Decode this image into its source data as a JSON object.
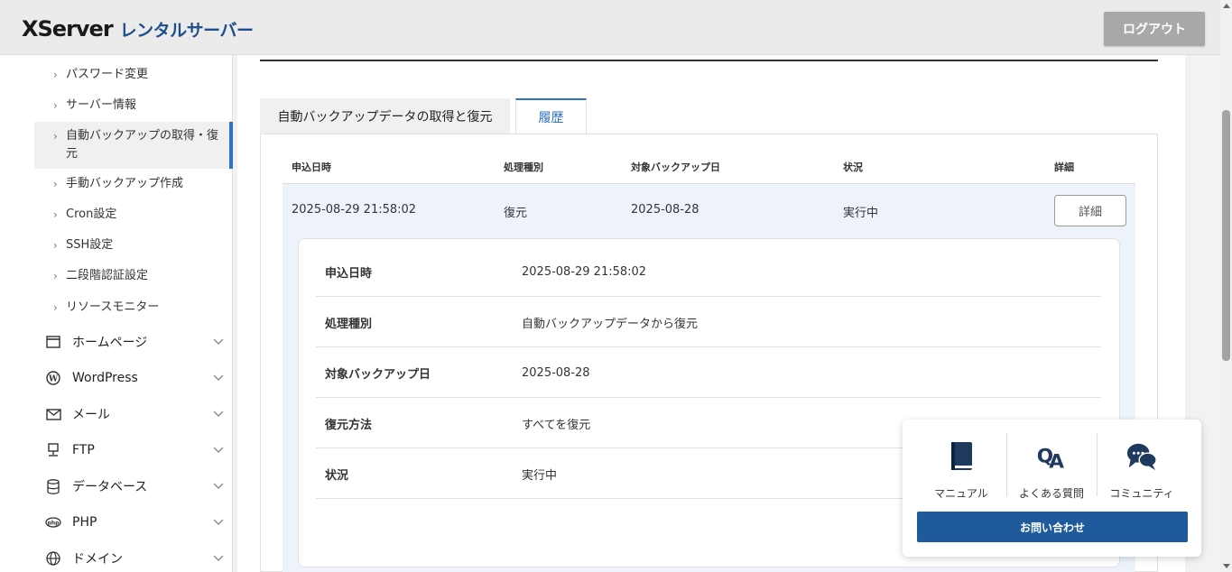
{
  "header": {
    "logo_main": "XServer",
    "logo_sub": "レンタルサーバー",
    "logout_label": "ログアウト"
  },
  "sidebar": {
    "sub_items": [
      {
        "label": "パスワード変更"
      },
      {
        "label": "サーバー情報"
      },
      {
        "label": "自動バックアップの取得・復元"
      },
      {
        "label": "手動バックアップ作成"
      },
      {
        "label": "Cron設定"
      },
      {
        "label": "SSH設定"
      },
      {
        "label": "二段階認証設定"
      },
      {
        "label": "リソースモニター"
      }
    ],
    "main_items": [
      {
        "label": "ホームページ",
        "icon": "browser-window-icon"
      },
      {
        "label": "WordPress",
        "icon": "wordpress-icon"
      },
      {
        "label": "メール",
        "icon": "mail-icon"
      },
      {
        "label": "FTP",
        "icon": "ftp-icon"
      },
      {
        "label": "データベース",
        "icon": "database-icon"
      },
      {
        "label": "PHP",
        "icon": "php-icon"
      },
      {
        "label": "ドメイン",
        "icon": "globe-icon"
      }
    ]
  },
  "tabs": [
    {
      "label": "自動バックアップデータの取得と復元"
    },
    {
      "label": "履歴"
    }
  ],
  "table": {
    "headers": [
      "申込日時",
      "処理種別",
      "対象バックアップ日",
      "状況",
      "詳細"
    ],
    "row": {
      "date": "2025-08-29 21:58:02",
      "type": "復元",
      "backup_date": "2025-08-28",
      "status": "実行中",
      "detail_label": "詳細"
    }
  },
  "detail": {
    "rows": [
      {
        "label": "申込日時",
        "value": "2025-08-29 21:58:02"
      },
      {
        "label": "処理種別",
        "value": "自動バックアップデータから復元"
      },
      {
        "label": "対象バックアップ日",
        "value": "2025-08-28"
      },
      {
        "label": "復元方法",
        "value": "すべてを復元"
      },
      {
        "label": "状況",
        "value": "実行中"
      }
    ]
  },
  "help": {
    "items": [
      {
        "label": "マニュアル",
        "icon": "book-icon"
      },
      {
        "label": "よくある質問",
        "icon": "qa-icon"
      },
      {
        "label": "コミュニティ",
        "icon": "chat-bubbles-icon"
      }
    ],
    "contact_label": "お問い合わせ"
  },
  "colors": {
    "accent": "#2d72c8",
    "brand_navy": "#1e4f8c",
    "contact_button": "#1e5a9c",
    "row_highlight": "#eef3fb"
  }
}
